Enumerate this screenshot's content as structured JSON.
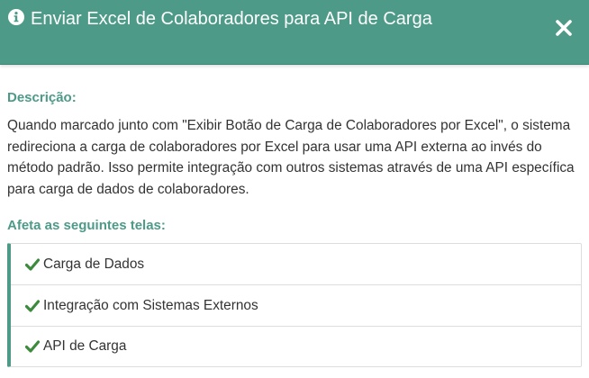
{
  "header": {
    "title": "Enviar Excel de Colaboradores para API de Carga",
    "info_icon": "info-circle-icon",
    "close_icon": "close-icon"
  },
  "description": {
    "label": "Descrição:",
    "text": "Quando marcado junto com \"Exibir Botão de Carga de Colaboradores por Excel\", o sistema redireciona a carga de colaboradores por Excel para usar uma API externa ao invés do método padrão. Isso permite integração com outros sistemas através de uma API específica para carga de dados de colaboradores."
  },
  "affects": {
    "label": "Afeta as seguintes telas:",
    "items": [
      {
        "label": "Carga de Dados",
        "icon": "check-icon"
      },
      {
        "label": "Integração com Sistemas Externos",
        "icon": "check-icon"
      },
      {
        "label": "API de Carga",
        "icon": "check-icon"
      }
    ]
  },
  "colors": {
    "header_bg": "#4c9a87",
    "accent": "#4c9a87",
    "check": "#3c8a3c",
    "text": "#333333"
  }
}
